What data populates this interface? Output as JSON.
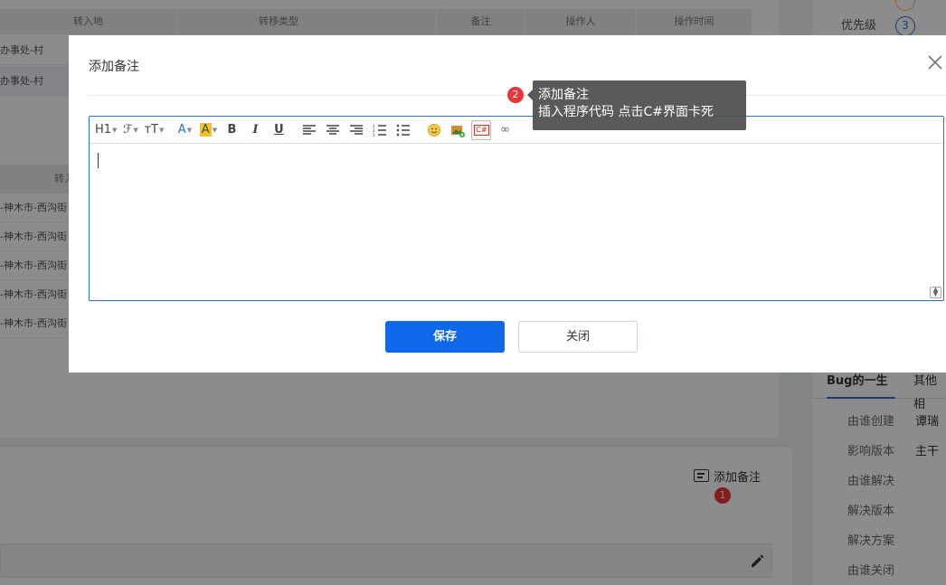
{
  "background": {
    "table1": {
      "headers": [
        "转入地",
        "转移类型",
        "备注",
        "操作人",
        "操作时间"
      ],
      "rows": [
        "办事处-村",
        "办事处-村"
      ]
    },
    "table2": {
      "header": "转入",
      "rows": [
        "-神木市-西沟街",
        "-神木市-西沟街",
        "-神木市-西沟街",
        "-神木市-西沟街",
        "-神木市-西沟街"
      ]
    },
    "add_note_link": "添加备注",
    "badge_1": "1",
    "right_panel": {
      "priority_label": "优先级",
      "priority_value": "3",
      "tabs": [
        "Bug的一生",
        "其他相"
      ],
      "props": [
        {
          "label": "由谁创建",
          "value": "谭瑞"
        },
        {
          "label": "影响版本",
          "value": "主干"
        },
        {
          "label": "由谁解决",
          "value": ""
        },
        {
          "label": "解决版本",
          "value": ""
        },
        {
          "label": "解决方案",
          "value": ""
        },
        {
          "label": "由谁关闭",
          "value": ""
        }
      ]
    }
  },
  "modal": {
    "title": "添加备注",
    "save_label": "保存",
    "close_label": "关闭",
    "toolbar": {
      "heading": "H1",
      "font_family": "ℱ",
      "font_size": "тT",
      "font_color": "A",
      "highlight": "A",
      "bold": "B",
      "italic": "I",
      "underline": "U",
      "code": "C#"
    }
  },
  "tooltip": {
    "badge": "2",
    "line1": "添加备注",
    "line2": "插入程序代码 点击C#界面卡死"
  },
  "colors": {
    "accent": "#0f67e9",
    "badge": "#e8363a",
    "editor_border": "#2b6fd6"
  }
}
